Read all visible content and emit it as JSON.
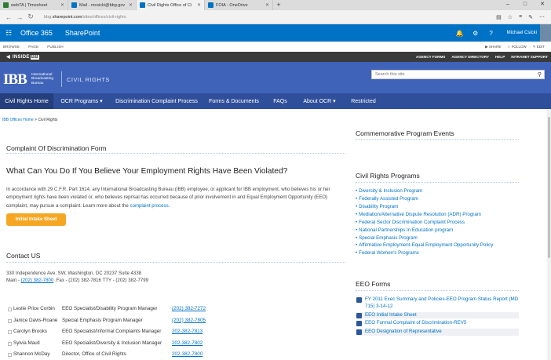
{
  "browser": {
    "tabs": [
      {
        "label": "webTA | Timesheet",
        "color": "#2e7d32"
      },
      {
        "label": "Mail - mcsicki@bbg.gov",
        "color": "#0072c6"
      },
      {
        "label": "Civil Rights Office of Ci",
        "color": "#0072c6"
      },
      {
        "label": "FOIA - OneDrive",
        "color": "#0072c6"
      }
    ],
    "active_tab": 2,
    "url_prefix": "bbg.",
    "url_domain": "sharepoint.com",
    "url_path": "/sites/offices/civil-rights"
  },
  "o365": {
    "app": "Office 365",
    "site": "SharePoint",
    "user": "Michael Csicki"
  },
  "ribbon": {
    "tabs": [
      "BROWSE",
      "PAGE",
      "PUBLISH"
    ],
    "actions": [
      "SHARE",
      "FOLLOW",
      "EDIT"
    ]
  },
  "inside": {
    "logo": "INSIDE",
    "logo_mark": "BB",
    "links": [
      "AGENCY FORMS",
      "AGENCY DIRECTORY",
      "HELP",
      "INTRANET SUPPORT"
    ]
  },
  "header": {
    "logo": "IBB",
    "logo_sub": [
      "International",
      "Broadcasting",
      "Bureau"
    ],
    "title": "CIVIL RIGHTS",
    "search_placeholder": "Search this site"
  },
  "nav": [
    {
      "label": "Civil Rights Home",
      "dropdown": false
    },
    {
      "label": "OCR Programs",
      "dropdown": true
    },
    {
      "label": "Discrimination Complaint Process",
      "dropdown": false
    },
    {
      "label": "Forms & Documents",
      "dropdown": false
    },
    {
      "label": "FAQs",
      "dropdown": false
    },
    {
      "label": "About OCR",
      "dropdown": true
    },
    {
      "label": "Restricted",
      "dropdown": false
    }
  ],
  "breadcrumb": {
    "root": "IBB Offices Home",
    "current": "Civil Rights"
  },
  "main": {
    "form_heading": "Complaint Of Discrimination Form",
    "question_heading": "What Can You Do If You Believe Your Employment Rights Have Been Violated?",
    "paragraph": "In accordance with 29 C.F.R. Part 1614, any International Broadcasting Bureau (IBB) employee, or applicant for IBB employment, who believes his or her employment rights have been violated or, who believes reprisal has occurred because of prior involvement in and Equal Employment Opportunity (EEO) complaint, may pursue a complaint. Learn more about the",
    "paragraph_link": "complaint process.",
    "intake_button": "Initial Intake Sheet",
    "contact_heading": "Contact US",
    "address": "330 Independence Ave. SW, Washington, DC 20237 Suite 4338",
    "main_label": "Main -",
    "main_phone": "(202) 382-7800",
    "fax_tty": "Fax - (202) 382-7816  TTY - (202) 382-7799"
  },
  "staff": [
    {
      "name": "Leslie Price Corbin",
      "title": "EEO Specialist/Disability Program Manager",
      "phone": "(202) 382-7272"
    },
    {
      "name": "Janice Davis-Roane",
      "title": "Special Emphasis Program Manager",
      "phone": "(202) 382-7805"
    },
    {
      "name": "Carolyn Brooks",
      "title": "EEO Specialist/Informal Complaints Manager",
      "phone": "202-382-7813"
    },
    {
      "name": "Sylvia Maull",
      "title": "EEO Specialist/Diversity & Inclusion Manager",
      "phone": "202-382-7802"
    },
    {
      "name": "Shannon McDay",
      "title": "Director, Office of Civil Rights",
      "phone": "202-382-7800"
    }
  ],
  "right": {
    "events_heading": "Commemorative Program Events",
    "programs_heading": "Civil Rights Programs",
    "programs": [
      "Diversity & Inclusion Program",
      "Federally Assisted Program",
      "Disability Program",
      "Mediation/Alternative Dispute Resolution (ADR) Program",
      "Federal Sector Discrimination Complaint Process",
      "National Partnerships In Education program",
      "Special Emphasis Program",
      "Affirmative Employment-Equal Employment Opportunity Policy",
      "Federal Women's Programs"
    ],
    "eeo_heading": "EEO Forms",
    "eeo_forms": [
      "FY 2011 Exec Summary and Policies-EEO Program Status Report (MD 715) 3-14-12",
      "EEO Initial Intake Sheet",
      "EEO Formal Complaint of Discrimination-REV5",
      "EEO Designation of Representative"
    ]
  },
  "colors": {
    "o365_blue": "#0072c6",
    "header_blue": "#3f63b8",
    "nav_blue": "#2f4f9a",
    "button_orange": "#f5a623"
  }
}
